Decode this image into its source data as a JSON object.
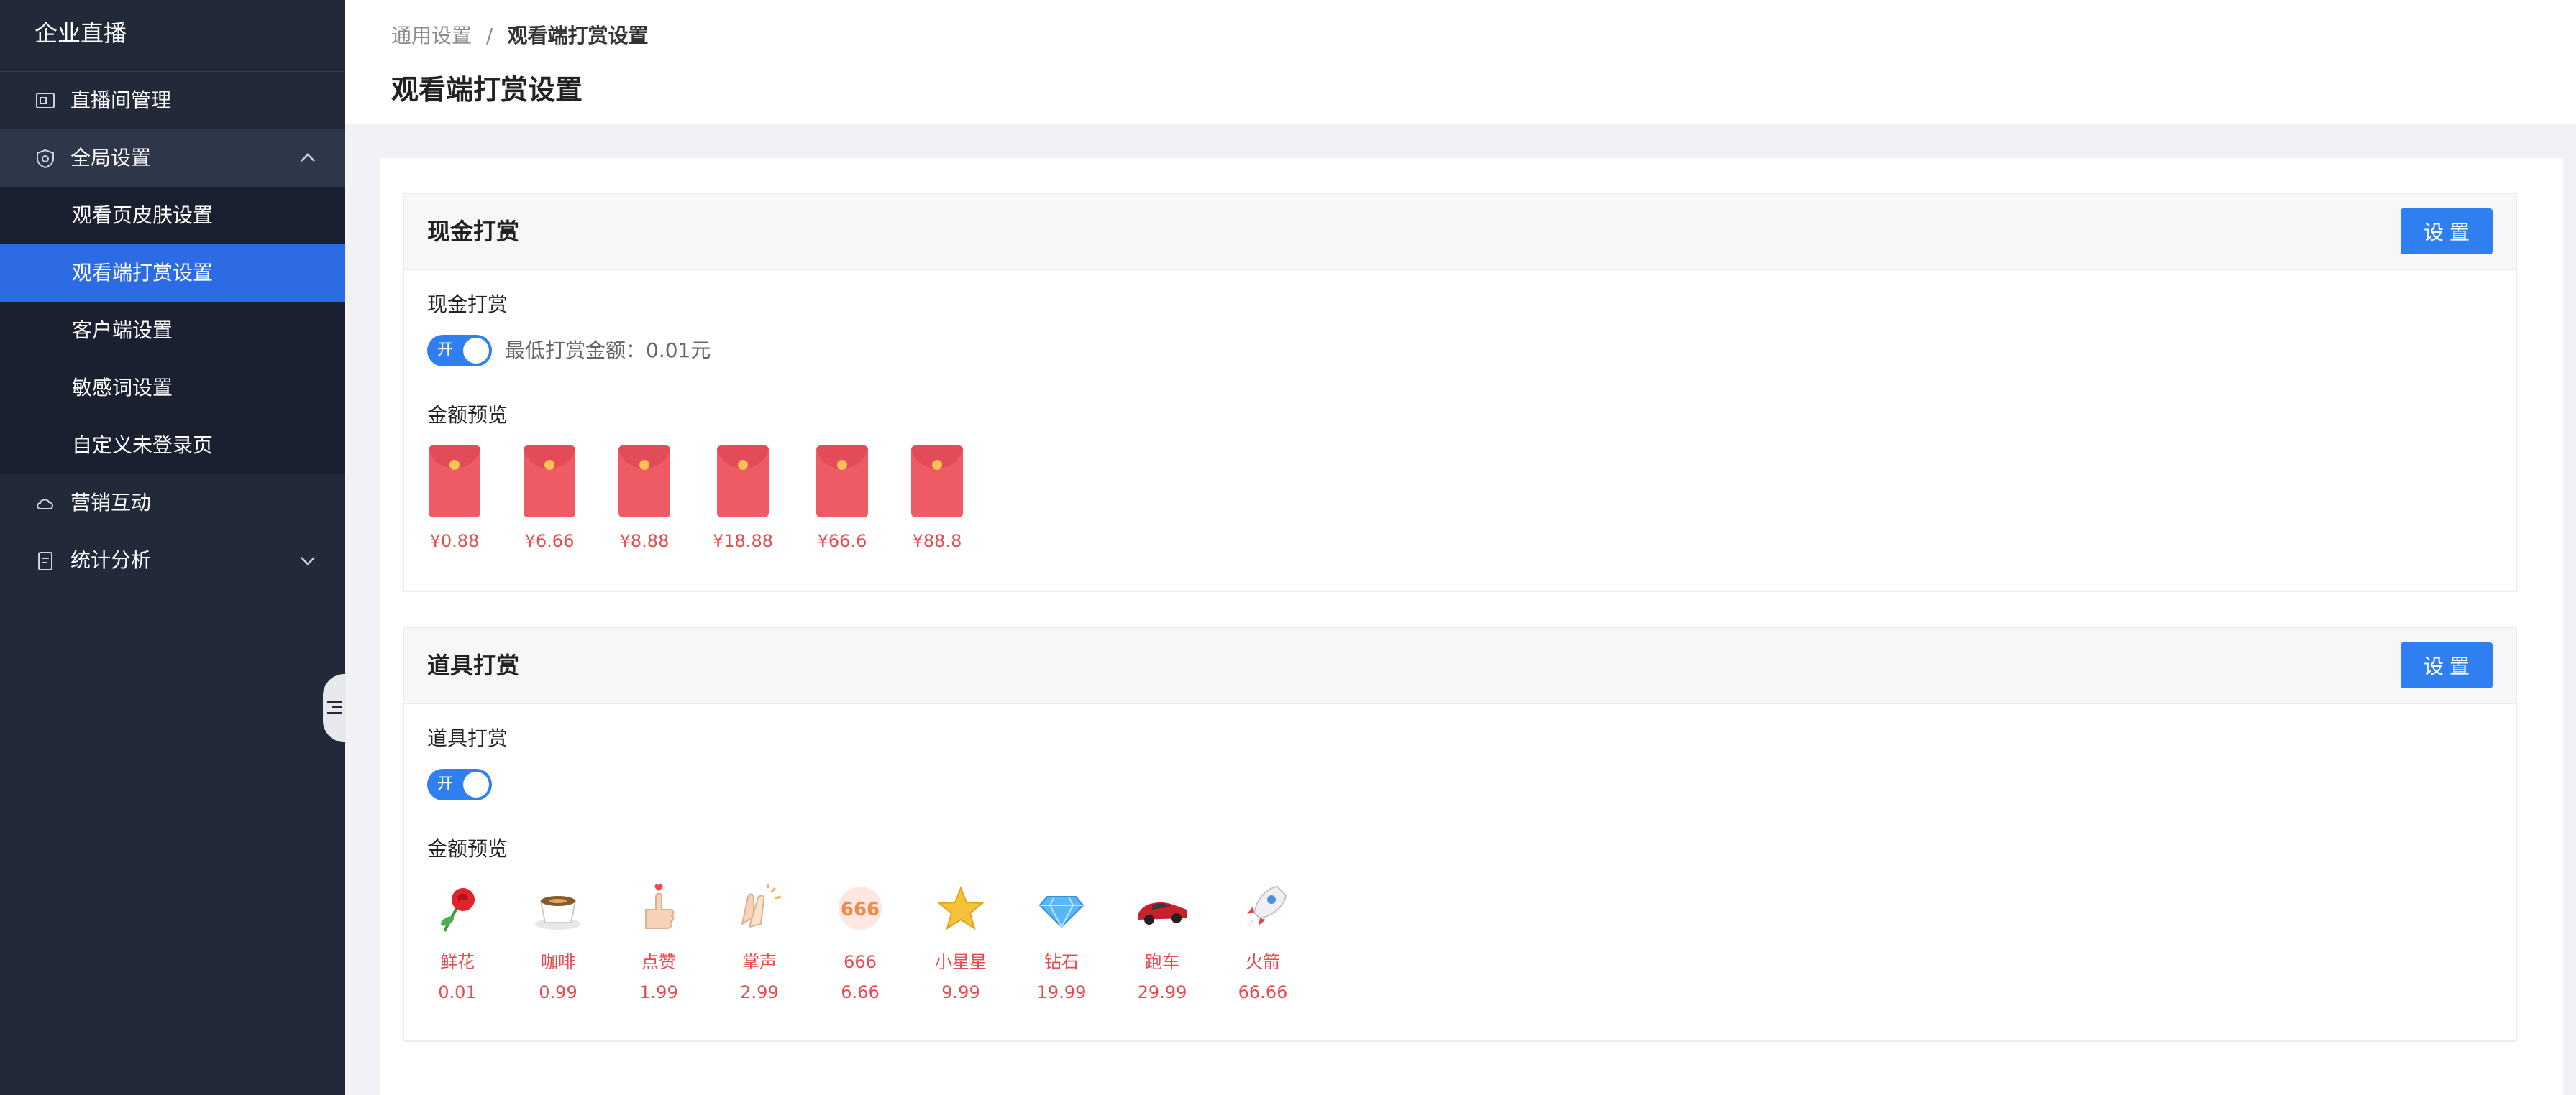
{
  "app": {
    "title": "企业直播"
  },
  "sidebar": {
    "items": [
      {
        "label": "直播间管理",
        "icon": "monitor-icon"
      },
      {
        "label": "全局设置",
        "icon": "shield-icon",
        "expanded": true,
        "children": [
          {
            "label": "观看页皮肤设置"
          },
          {
            "label": "观看端打赏设置",
            "active": true
          },
          {
            "label": "客户端设置"
          },
          {
            "label": "敏感词设置"
          },
          {
            "label": "自定义未登录页"
          }
        ]
      },
      {
        "label": "营销互动",
        "icon": "cloud-icon"
      },
      {
        "label": "统计分析",
        "icon": "report-icon",
        "expanded": false
      }
    ]
  },
  "header": {
    "breadcrumb": {
      "parent": "通用设置",
      "separator": "/",
      "current": "观看端打赏设置"
    },
    "title": "观看端打赏设置"
  },
  "cash_reward": {
    "title": "现金打赏",
    "button": "设置",
    "field_label": "现金打赏",
    "toggle": {
      "on": true,
      "label": "开"
    },
    "min_amount": "最低打赏金额：0.01元",
    "preview_label": "金额预览",
    "amounts": [
      "¥0.88",
      "¥6.66",
      "¥8.88",
      "¥18.88",
      "¥66.6",
      "¥88.8"
    ]
  },
  "prop_reward": {
    "title": "道具打赏",
    "button": "设置",
    "field_label": "道具打赏",
    "toggle": {
      "on": true,
      "label": "开"
    },
    "preview_label": "金额预览",
    "gifts": [
      {
        "name": "鲜花",
        "price": "0.01",
        "icon": "rose-icon"
      },
      {
        "name": "咖啡",
        "price": "0.99",
        "icon": "coffee-icon"
      },
      {
        "name": "点赞",
        "price": "1.99",
        "icon": "thumbs-up-icon"
      },
      {
        "name": "掌声",
        "price": "2.99",
        "icon": "clap-icon"
      },
      {
        "name": "666",
        "price": "6.66",
        "icon": "666-badge-icon"
      },
      {
        "name": "小星星",
        "price": "9.99",
        "icon": "star-icon"
      },
      {
        "name": "钻石",
        "price": "19.99",
        "icon": "diamond-icon"
      },
      {
        "name": "跑车",
        "price": "29.99",
        "icon": "sports-car-icon"
      },
      {
        "name": "火箭",
        "price": "66.66",
        "icon": "rocket-icon"
      }
    ]
  },
  "colors": {
    "sidebar_bg": "#222a3a",
    "active_item": "#2d6be4",
    "primary_button": "#2f7ff0",
    "price_text": "#e84a50",
    "envelope": "#ef5b65"
  }
}
